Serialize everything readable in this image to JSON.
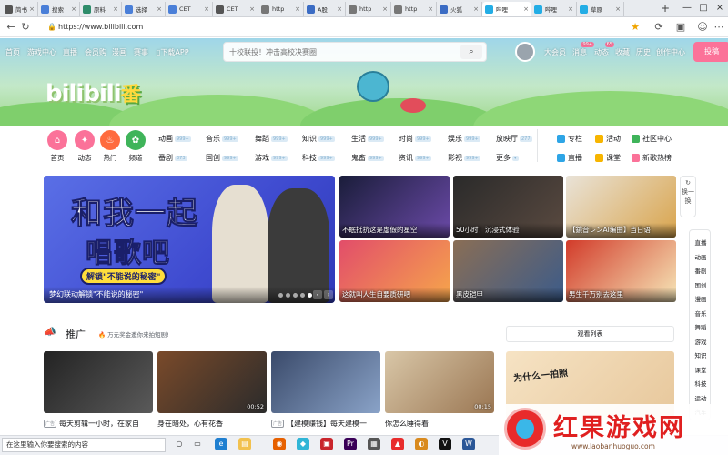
{
  "browser": {
    "tabs": [
      {
        "label": "简书",
        "color": "#555"
      },
      {
        "label": "搜索",
        "color": "#4a7fd8"
      },
      {
        "label": "原料",
        "color": "#2e8c6a"
      },
      {
        "label": "选择",
        "color": "#4a7fd8"
      },
      {
        "label": "CET",
        "color": "#4a7fd8"
      },
      {
        "label": "CET",
        "color": "#555"
      },
      {
        "label": "http",
        "color": "#777"
      },
      {
        "label": "A股",
        "color": "#3b6cc4"
      },
      {
        "label": "http",
        "color": "#777"
      },
      {
        "label": "http",
        "color": "#777"
      },
      {
        "label": "火狐",
        "color": "#3b6cc4"
      },
      {
        "label": "哔哩",
        "color": "#23ade5"
      },
      {
        "label": "哔哩",
        "color": "#23ade5"
      },
      {
        "label": "草原",
        "color": "#23ade5"
      }
    ],
    "active_tab": 11,
    "new_tab": "+",
    "url": "https://www.bilibili.com",
    "win_controls": [
      "—",
      "□",
      "×"
    ]
  },
  "bili": {
    "nav_left": [
      "首页",
      "游戏中心",
      "直播",
      "会员购",
      "漫画",
      "赛事",
      "下载APP"
    ],
    "search_placeholder": "十校联投！冲击高校决赛圈",
    "search_icon": "search-icon",
    "nav_right": [
      "大会员",
      "消息",
      "动态",
      "收藏",
      "历史",
      "创作中心"
    ],
    "badges": {
      "message": "99+",
      "dynamic": "65"
    },
    "upload": "投稿",
    "logo_text": "bilibili",
    "logo_suffix": "番",
    "channels": [
      {
        "label": "首页",
        "color": "#fb7299",
        "icon": "home-icon",
        "glyph": "⌂"
      },
      {
        "label": "动态",
        "color": "#fb7299",
        "icon": "moment-icon",
        "glyph": "✦"
      },
      {
        "label": "热门",
        "color": "#ff6b3e",
        "icon": "fire-icon",
        "glyph": "♨"
      },
      {
        "label": "频道",
        "color": "#3fb45a",
        "icon": "channel-icon",
        "glyph": "✿"
      }
    ],
    "categories_row1": [
      {
        "name": "动画",
        "count": "999+"
      },
      {
        "name": "音乐",
        "count": "999+"
      },
      {
        "name": "舞蹈",
        "count": "999+"
      },
      {
        "name": "知识",
        "count": "999+"
      },
      {
        "name": "生活",
        "count": "999+"
      },
      {
        "name": "时尚",
        "count": "999+"
      },
      {
        "name": "娱乐",
        "count": "999+"
      },
      {
        "name": "放映厅",
        "count": "277"
      }
    ],
    "categories_row2": [
      {
        "name": "番剧",
        "count": "373"
      },
      {
        "name": "国创",
        "count": "999+"
      },
      {
        "name": "游戏",
        "count": "999+"
      },
      {
        "name": "科技",
        "count": "999+"
      },
      {
        "name": "鬼畜",
        "count": "999+"
      },
      {
        "name": "资讯",
        "count": "999+"
      },
      {
        "name": "影视",
        "count": "999+"
      },
      {
        "name": "更多",
        "count": "▾"
      }
    ],
    "right_links": [
      {
        "name": "专栏",
        "color": "#2ea5e6"
      },
      {
        "name": "活动",
        "color": "#f7b500"
      },
      {
        "name": "社区中心",
        "color": "#3fb45a"
      },
      {
        "name": "直播",
        "color": "#2ea5e6"
      },
      {
        "name": "课堂",
        "color": "#f7b500"
      },
      {
        "name": "新歌热榜",
        "color": "#fb7299"
      }
    ],
    "carousel": {
      "headline1": "和我一起",
      "headline2": "唱歌吧",
      "unlock": "解锁\"不能说的秘密\"",
      "caption": "梦幻联动解锁\"不能说的秘密\"",
      "dots": 5,
      "active_dot": 4
    },
    "videos_top": [
      {
        "title": "不眠抵抗这是虚假的星空",
        "bg1": "#1a1d3a",
        "bg2": "#6b4aa8"
      },
      {
        "title": "50小时！沉浸式体验",
        "bg1": "#2a2a2a",
        "bg2": "#5a4a40"
      },
      {
        "title": "【鏡音レンAI编曲】当日语",
        "bg1": "#e9e3d8",
        "bg2": "#d9a44c"
      },
      {
        "title": "这就叫人生自要质研吧",
        "bg1": "#e24d6a",
        "bg2": "#f6a64b"
      },
      {
        "title": "黑皮铠甲",
        "bg1": "#8a6e55",
        "bg2": "#3b5b8a"
      },
      {
        "title": "男生千万别去这里",
        "bg1": "#d23b2a",
        "bg2": "#f6e7b8"
      }
    ],
    "refresh": "换一换",
    "side_nav": [
      "直播",
      "动画",
      "番剧",
      "国创",
      "漫画",
      "音乐",
      "舞蹈",
      "游戏",
      "知识",
      "课堂",
      "科技",
      "运动",
      "汽车"
    ],
    "promo": {
      "title": "推广",
      "note": "万元奖金邀你来拍短剧!",
      "watchlist": "观看列表"
    },
    "videos_bottom": [
      {
        "title": "每天剪辑一小时，在家自",
        "dur": "",
        "ad": true,
        "bg1": "#232323",
        "bg2": "#5a5a5a"
      },
      {
        "title": "身在暗处，心有花香",
        "dur": "00:52",
        "ad": false,
        "bg1": "#7a4a2a",
        "bg2": "#2b2b2b"
      },
      {
        "title": "【建模赚钱】每天建模一",
        "dur": "",
        "ad": true,
        "bg1": "#3a4a6a",
        "bg2": "#8aa3c8"
      },
      {
        "title": "你怎么睡得着",
        "dur": "00:15",
        "ad": false,
        "bg1": "#d9c7a8",
        "bg2": "#9a7652"
      }
    ],
    "promo_right_text": "为什么一拍照"
  },
  "taskbar": {
    "search": "在这里输入你要搜索的内容"
  },
  "watermark": {
    "text": "红果游戏网",
    "url": "www.laobanhuoguo.com"
  }
}
